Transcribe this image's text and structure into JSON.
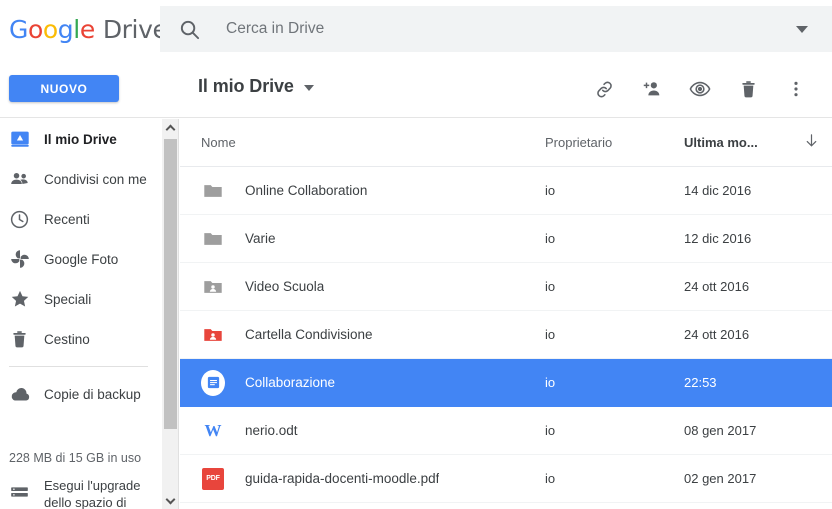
{
  "brand": {
    "google": [
      "G",
      "o",
      "o",
      "g",
      "l",
      "e"
    ],
    "product": "Drive"
  },
  "search": {
    "placeholder": "Cerca in Drive",
    "value": "",
    "icon": "search-icon",
    "dropdown_icon": "chevron-down-icon"
  },
  "subbar": {
    "new_button": "NUOVO",
    "breadcrumb": "Il mio Drive",
    "breadcrumb_caret": "chevron-down-icon",
    "tools": [
      {
        "name": "get-link-icon",
        "label": "Ottieni link condivisibile"
      },
      {
        "name": "add-person-icon",
        "label": "Condividi"
      },
      {
        "name": "preview-eye-icon",
        "label": "Anteprima"
      },
      {
        "name": "trash-icon",
        "label": "Rimuovi"
      },
      {
        "name": "more-options-icon",
        "label": "Altre azioni"
      }
    ]
  },
  "sidebar": {
    "items": [
      {
        "label": "Il mio Drive",
        "icon": "drive-computer-icon",
        "active": true
      },
      {
        "label": "Condivisi con me",
        "icon": "people-icon",
        "active": false
      },
      {
        "label": "Recenti",
        "icon": "clock-icon",
        "active": false
      },
      {
        "label": "Google Foto",
        "icon": "photos-pinwheel-icon",
        "active": false
      },
      {
        "label": "Speciali",
        "icon": "star-icon",
        "active": false
      },
      {
        "label": "Cestino",
        "icon": "trash-icon",
        "active": false
      }
    ],
    "backup": {
      "label": "Copie di backup",
      "icon": "cloud-icon"
    },
    "storage_text": "228 MB di 15 GB in uso",
    "upgrade": {
      "line1": "Esegui l'upgrade",
      "line2": "dello spazio di",
      "icon": "storage-bars-icon"
    }
  },
  "scrollbar": {
    "up_icon": "chevron-up-icon",
    "down_icon": "chevron-down-icon"
  },
  "list": {
    "headers": {
      "name": "Nome",
      "owner": "Proprietario",
      "modified": "Ultima mo...",
      "sort_icon": "arrow-down-icon"
    },
    "rows": [
      {
        "name": "Online Collaboration",
        "owner": "io",
        "modified": "14 dic 2016",
        "icon": "folder-icon",
        "icon_color": "#9e9e9e",
        "selected": false
      },
      {
        "name": "Varie",
        "owner": "io",
        "modified": "12 dic 2016",
        "icon": "folder-icon",
        "icon_color": "#9e9e9e",
        "selected": false
      },
      {
        "name": "Video Scuola",
        "owner": "io",
        "modified": "24 ott 2016",
        "icon": "shared-folder-icon",
        "icon_color": "#9e9e9e",
        "selected": false
      },
      {
        "name": "Cartella Condivisione",
        "owner": "io",
        "modified": "24 ott 2016",
        "icon": "shared-folder-icon",
        "icon_color": "#E8453C",
        "selected": false
      },
      {
        "name": "Collaborazione",
        "owner": "io",
        "modified": "22:53",
        "icon": "google-doc-icon",
        "icon_color": "#4285F4",
        "selected": true
      },
      {
        "name": "nerio.odt",
        "owner": "io",
        "modified": "08 gen 2017",
        "icon": "word-document-icon",
        "icon_color": "#4285F4",
        "selected": false,
        "badge": "W"
      },
      {
        "name": "guida-rapida-docenti-moodle.pdf",
        "owner": "io",
        "modified": "02 gen 2017",
        "icon": "pdf-icon",
        "icon_color": "#E8453C",
        "selected": false,
        "badge": "PDF"
      }
    ]
  },
  "colors": {
    "accent_blue": "#4285F4",
    "red": "#EA4335",
    "yellow": "#FBBC05",
    "green": "#34A853",
    "selected_row": "#4285F4",
    "search_bg": "#f1f3f4"
  }
}
